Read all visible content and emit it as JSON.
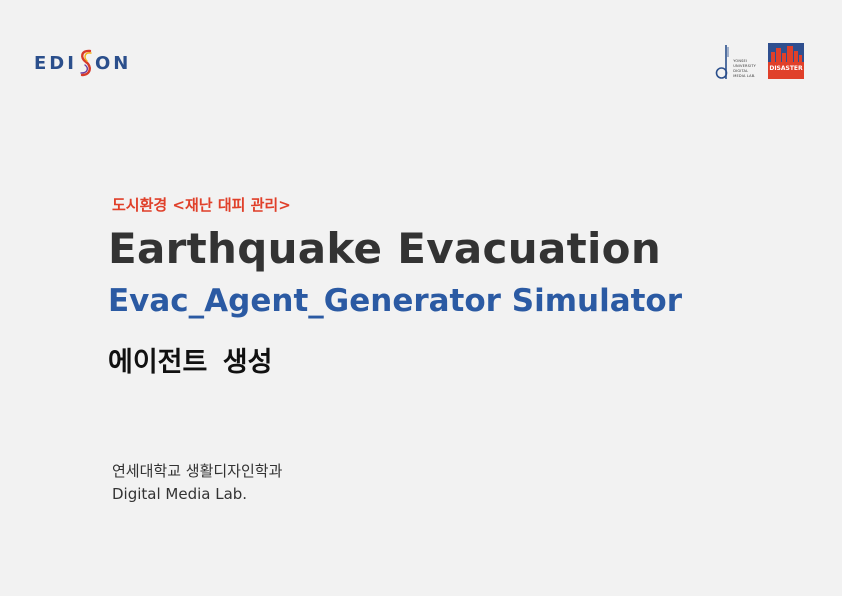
{
  "brand": {
    "logo_left": "EDISON",
    "logo_left_prefix": "EDI",
    "logo_left_suffix": "ON",
    "lab_logo_text": [
      "YONSEI",
      "UNIVERSITY",
      "DIGITAL",
      "MEDIA LAB."
    ],
    "disaster_logo_text": "DISASTER",
    "colors": {
      "edison_blue": "#2b4f8c",
      "accent_red": "#e0402a",
      "sim_blue": "#2b5aa3",
      "title_gray": "#333333",
      "background": "#f2f2f2"
    }
  },
  "header": {
    "category": "도시환경 <재난 대피 관리>",
    "title": "Earthquake Evacuation",
    "simulator": "Evac_Agent_Generator Simulator",
    "title_ko": "에이전트  생성"
  },
  "affiliation": {
    "university": "연세대학교 생활디자인학과",
    "lab": "Digital Media Lab."
  }
}
